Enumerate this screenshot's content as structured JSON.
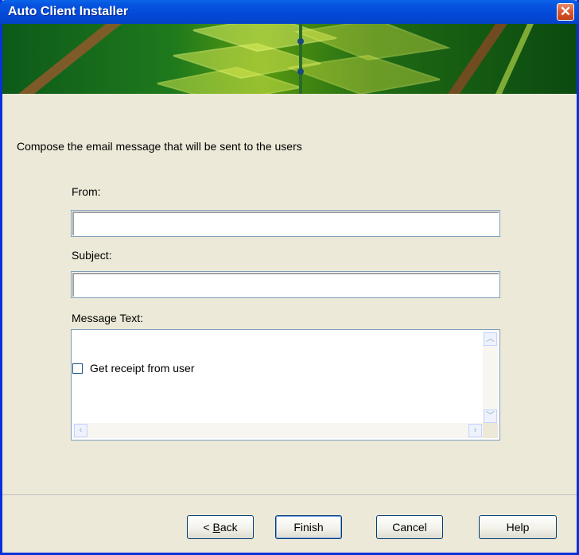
{
  "window": {
    "title": "Auto Client Installer",
    "close_label": "✕"
  },
  "instruction": "Compose the email message that will be sent to the users",
  "form": {
    "from_label": "From:",
    "from_value": "",
    "subject_label": "Subject:",
    "subject_value": "",
    "message_label": "Message Text:",
    "message_value": "",
    "receipt_label": "Get receipt from user",
    "receipt_checked": false
  },
  "buttons": {
    "back_prefix": "< ",
    "back_letter": "B",
    "back_rest": "ack",
    "finish": "Finish",
    "cancel": "Cancel",
    "help": "Help"
  }
}
